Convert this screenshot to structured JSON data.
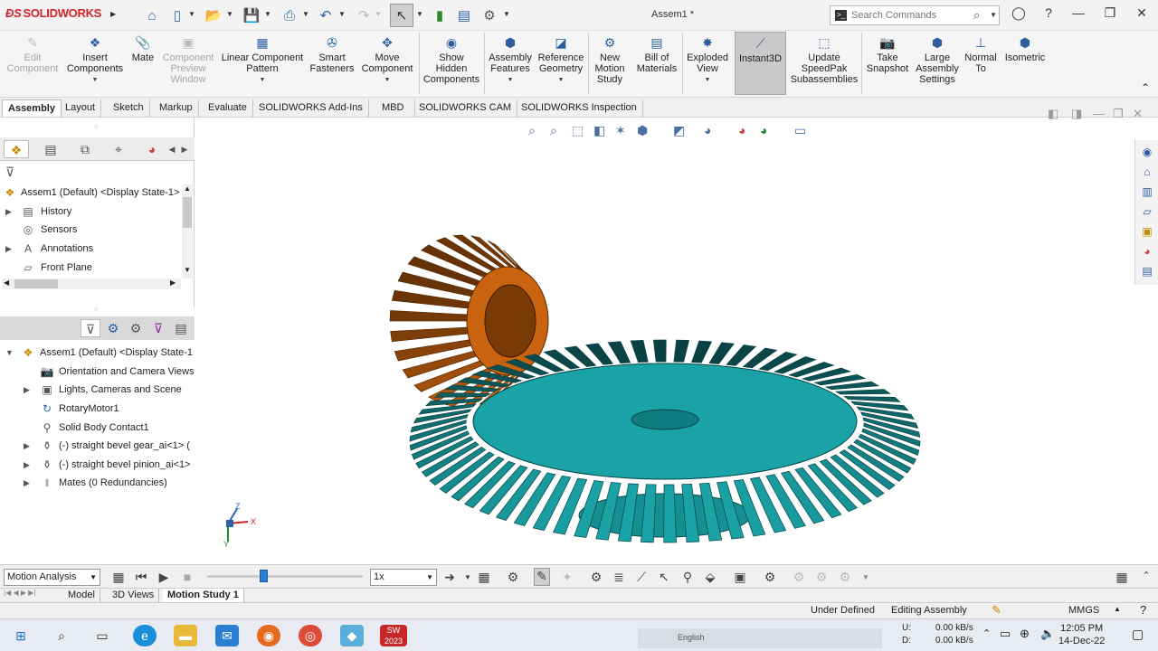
{
  "app": {
    "logo_text": "SOLIDWORKS",
    "doc_title": "Assem1 *"
  },
  "search": {
    "placeholder": "Search Commands"
  },
  "ribbon": [
    {
      "label": "Edit\nComponent",
      "disabled": true
    },
    {
      "label": "Insert\nComponents",
      "disabled": false
    },
    {
      "label": "Mate",
      "disabled": false
    },
    {
      "label": "Component\nPreview\nWindow",
      "disabled": true
    },
    {
      "label": "Linear Component\nPattern",
      "disabled": false
    },
    {
      "label": "Smart\nFasteners",
      "disabled": false
    },
    {
      "label": "Move\nComponent",
      "disabled": false
    },
    {
      "label": "Show\nHidden\nComponents",
      "disabled": false
    },
    {
      "label": "Assembly\nFeatures",
      "disabled": false
    },
    {
      "label": "Reference\nGeometry",
      "disabled": false
    },
    {
      "label": "New\nMotion\nStudy",
      "disabled": false
    },
    {
      "label": "Bill of\nMaterials",
      "disabled": false
    },
    {
      "label": "Exploded\nView",
      "disabled": false
    },
    {
      "label": "Instant3D",
      "disabled": false
    },
    {
      "label": "Update\nSpeedPak\nSubassemblies",
      "disabled": false
    },
    {
      "label": "Take\nSnapshot",
      "disabled": false
    },
    {
      "label": "Large\nAssembly\nSettings",
      "disabled": false
    },
    {
      "label": "Normal\nTo",
      "disabled": false
    },
    {
      "label": "Isometric",
      "disabled": false
    }
  ],
  "tabs": [
    "Assembly",
    "Layout",
    "Sketch",
    "Markup",
    "Evaluate",
    "SOLIDWORKS Add-Ins",
    "MBD",
    "SOLIDWORKS CAM",
    "SOLIDWORKS Inspection"
  ],
  "feature_tree": [
    {
      "label": "Assem1 (Default) <Display State-1>"
    },
    {
      "label": "History"
    },
    {
      "label": "Sensors"
    },
    {
      "label": "Annotations"
    },
    {
      "label": "Front Plane"
    }
  ],
  "motion_tree": [
    {
      "label": "Assem1 (Default) <Display State-1"
    },
    {
      "label": "Orientation and Camera Views"
    },
    {
      "label": "Lights, Cameras and Scene"
    },
    {
      "label": "RotaryMotor1"
    },
    {
      "label": "Solid Body Contact1"
    },
    {
      "label": "(-) straight bevel gear_ai<1> ("
    },
    {
      "label": "(-) straight bevel pinion_ai<1>"
    },
    {
      "label": "Mates (0 Redundancies)"
    }
  ],
  "motion_manager": {
    "study_type": "Motion Analysis",
    "speed": "1x",
    "timeline_position": 0.37
  },
  "bottom_tabs": [
    "Model",
    "3D Views",
    "Motion Study 1"
  ],
  "status": {
    "defined": "Under Defined",
    "mode": "Editing Assembly",
    "units": "MMGS"
  },
  "taskbar": {
    "net_up": "U:",
    "net_down": "D:",
    "up_rate": "0.00 kB/s",
    "down_rate": "0.00 kB/s",
    "sw_badge": "2023",
    "lang": "English",
    "time": "12:05 PM",
    "date": "14-Dec-22"
  },
  "triad": {
    "x": "X",
    "y": "Y",
    "z": "Z"
  },
  "colors": {
    "pinion": "#c9630f",
    "gear": "#1aa3a6",
    "accent": "#d2232a"
  }
}
